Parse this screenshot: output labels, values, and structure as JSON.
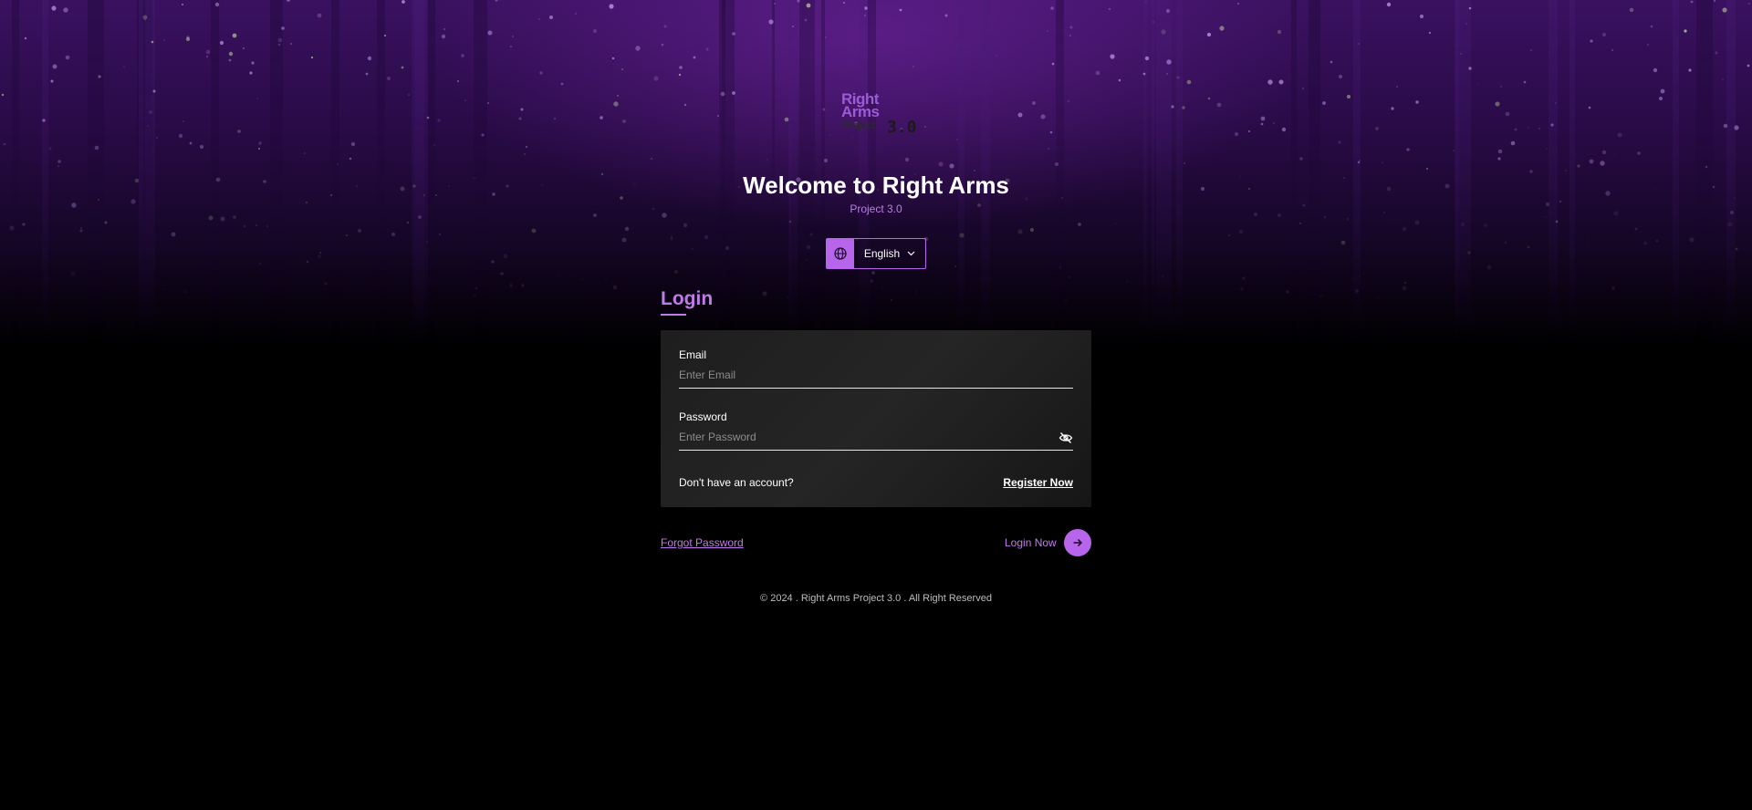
{
  "branding": {
    "logo_line1": "Right",
    "logo_line2": "Arms",
    "logo_line3": "Project",
    "logo_version": "3.0",
    "welcome_title": "Welcome to Right Arms",
    "subtitle": "Project 3.0"
  },
  "language": {
    "selected": "English",
    "icon": "globe-icon"
  },
  "login": {
    "title": "Login",
    "email_label": "Email",
    "email_placeholder": "Enter Email",
    "email_value": "",
    "password_label": "Password",
    "password_placeholder": "Enter Password",
    "password_value": "",
    "no_account_text": "Don't have an account?",
    "register_label": "Register Now",
    "forgot_label": "Forgot Password",
    "login_now_label": "Login Now"
  },
  "footer": {
    "copyright": "© 2024 . Right Arms Project 3.0 . All Right Reserved"
  },
  "colors": {
    "accent": "#b765ea",
    "accent_text": "#c07be8",
    "background": "#000000",
    "card": "#1e1e1e"
  }
}
